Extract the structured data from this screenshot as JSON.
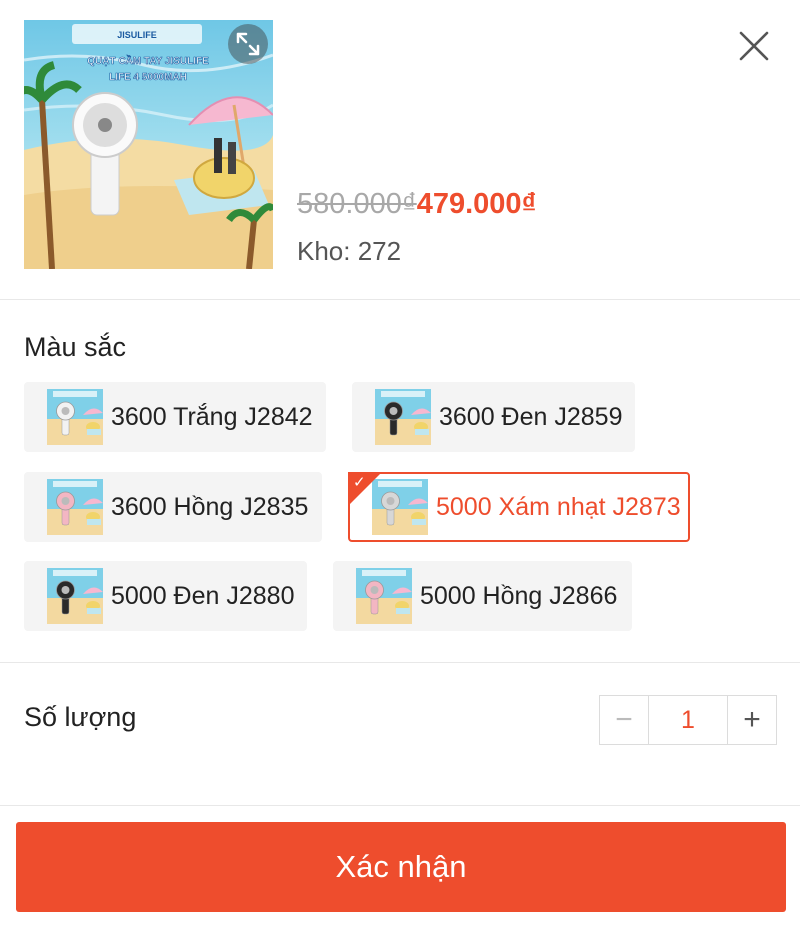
{
  "product": {
    "image_text_line1": "QUẠT CẦM TAY JISULIFE",
    "image_text_line2": "LIFE 4 5000MAH",
    "image_brand": "JISULIFE",
    "old_price": "580.000₫",
    "new_price": "479.000₫",
    "stock_label": "Kho: ",
    "stock_value": "272"
  },
  "variation": {
    "title": "Màu sắc",
    "options": [
      {
        "label": "3600 Trắng J2842",
        "fan_color": "#f2f2f2",
        "selected": false
      },
      {
        "label": "3600 Đen J2859",
        "fan_color": "#2a2a2a",
        "selected": false
      },
      {
        "label": "3600 Hồng J2835",
        "fan_color": "#f3b6c3",
        "selected": false
      },
      {
        "label": "5000 Xám nhạt J2873",
        "fan_color": "#d7d7d7",
        "selected": true
      },
      {
        "label": "5000 Đen J2880",
        "fan_color": "#2a2a2a",
        "selected": false
      },
      {
        "label": "5000 Hồng J2866",
        "fan_color": "#f3b6c3",
        "selected": false
      }
    ]
  },
  "quantity": {
    "label": "Số lượng",
    "value": "1",
    "minus": "−",
    "plus": "+"
  },
  "confirm_label": "Xác nhận",
  "colors": {
    "accent": "#ee4d2d",
    "muted": "#a8a8a8"
  },
  "icons": {
    "close": "close-icon",
    "expand": "expand-icon",
    "check": "check-icon"
  }
}
